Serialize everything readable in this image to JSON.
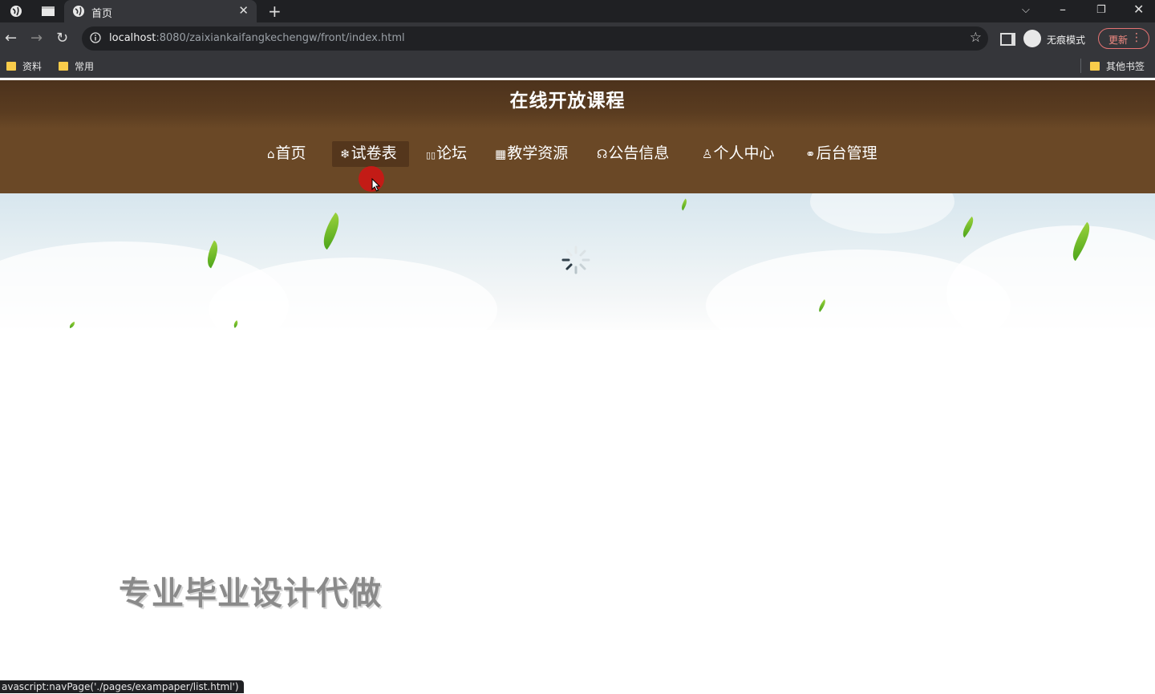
{
  "browser": {
    "tab_title": "首页",
    "url_host": "localhost",
    "url_rest": ":8080/zaixiankaifangkechengw/front/index.html",
    "profile_label": "无痕模式",
    "update_label": "更新",
    "bookmarks": [
      {
        "label": "资料"
      },
      {
        "label": "常用"
      }
    ],
    "other_bookmarks": "其他书签",
    "status_url": "avascript:navPage('./pages/exampaper/list.html')"
  },
  "site": {
    "title": "在线开放课程",
    "nav": [
      {
        "icon": "⌂",
        "label": "首页",
        "icon_name": "home-icon"
      },
      {
        "icon": "❄",
        "label": "试卷表",
        "icon_name": "snowflake-icon",
        "active": true
      },
      {
        "icon": "▯▯",
        "label": "论坛",
        "icon_name": "forum-icon"
      },
      {
        "icon": "▦",
        "label": "教学资源",
        "icon_name": "grid-icon"
      },
      {
        "icon": "☊",
        "label": "公告信息",
        "icon_name": "notice-icon"
      },
      {
        "icon": "♙",
        "label": "个人中心",
        "icon_name": "user-icon"
      },
      {
        "icon": "⚭",
        "label": "后台管理",
        "icon_name": "link-icon"
      }
    ],
    "promo_text": "专业毕业设计代做"
  },
  "colors": {
    "header_brown": "#6a4826",
    "active_nav": "#54361c",
    "chrome_dark": "#35363a"
  }
}
